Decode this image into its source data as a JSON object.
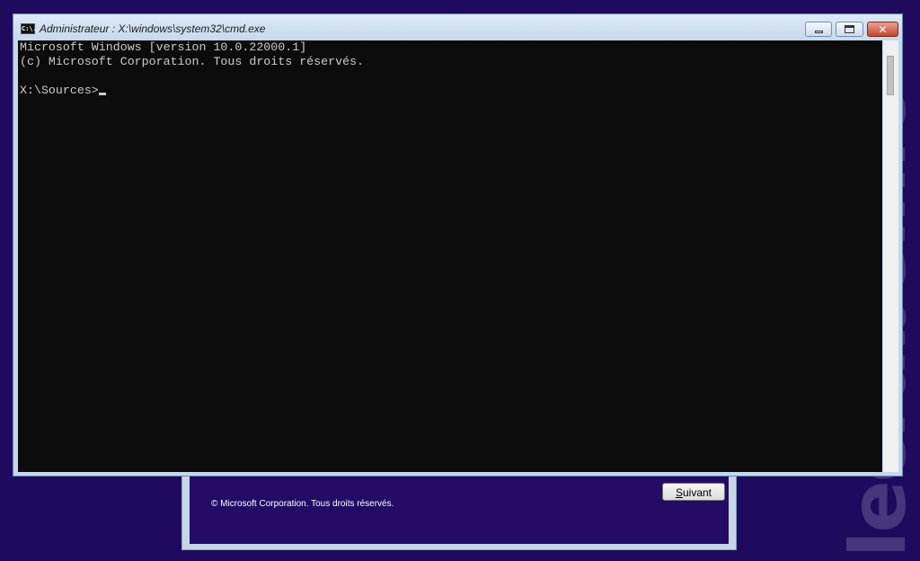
{
  "setup": {
    "copyright": "© Microsoft Corporation. Tous droits réservés.",
    "next_prefix": "",
    "next_underlined": "S",
    "next_rest": "uivant"
  },
  "watermark": "lecrabeinfo",
  "cmd": {
    "title": "Administrateur : X:\\windows\\system32\\cmd.exe",
    "icon_text": "C:\\.",
    "lines": [
      "Microsoft Windows [version 10.0.22000.1]",
      "(c) Microsoft Corporation. Tous droits réservés.",
      "",
      "X:\\Sources>"
    ]
  },
  "icons": {
    "app": "cmd-app-icon",
    "minimize": "minimize-icon",
    "maximize": "maximize-icon",
    "close": "close-icon"
  },
  "colors": {
    "desktop": "#1f0a5e",
    "console_bg": "#0c0c0c",
    "console_fg": "#cccccc",
    "close_button": "#c7442d"
  }
}
